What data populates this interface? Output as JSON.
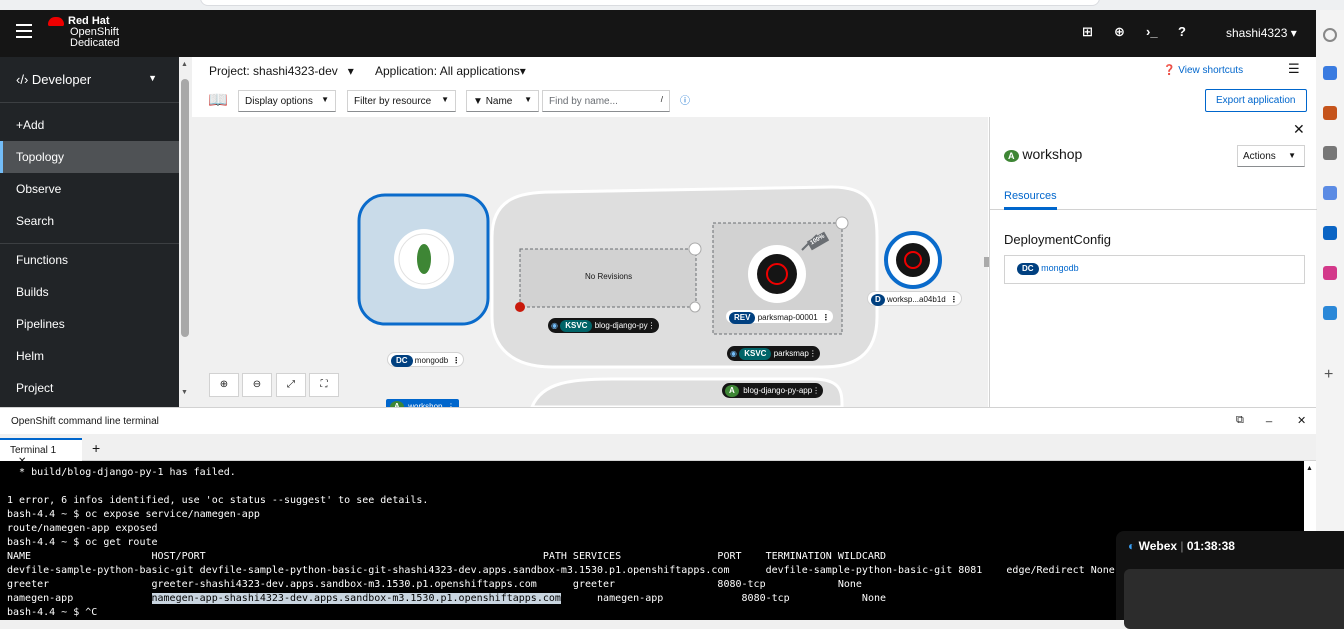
{
  "brand": {
    "line1": "Red Hat",
    "line2": "OpenShift",
    "line3": "Dedicated"
  },
  "masthead": {
    "user": "shashi4323"
  },
  "sidebar": {
    "perspective": "Developer",
    "items": [
      {
        "label": "+Add"
      },
      {
        "label": "Topology",
        "active": true
      },
      {
        "label": "Observe"
      },
      {
        "label": "Search"
      },
      {
        "label": "Functions"
      },
      {
        "label": "Builds"
      },
      {
        "label": "Pipelines"
      },
      {
        "label": "Helm"
      },
      {
        "label": "Project"
      }
    ]
  },
  "projectbar": {
    "project": "Project: shashi4323-dev",
    "application": "Application: All applications",
    "view_shortcuts": "View shortcuts"
  },
  "toolbar": {
    "display_options": "Display options",
    "filter_by_resource": "Filter by resource",
    "filter_type": "Name",
    "filter_placeholder": "Find by name...",
    "filter_hint": "/",
    "export": "Export application"
  },
  "topology": {
    "mongodb": {
      "badge": "DC",
      "label": "mongodb"
    },
    "workshop_group": {
      "badge": "A",
      "label": "workshop"
    },
    "no_revisions": "No Revisions",
    "blog_ksvc": {
      "badge": "KSVC",
      "label": "blog-django-py"
    },
    "parksmap_rev": {
      "badge": "REV",
      "label": "parksmap-00001",
      "traffic": "100%"
    },
    "parksmap_ksvc": {
      "badge": "KSVC",
      "label": "parksmap"
    },
    "workshop_d": {
      "badge": "D",
      "label": "worksp...a04b1d"
    },
    "blog_app": {
      "badge": "A",
      "label": "blog-django-py-app"
    }
  },
  "panel": {
    "badge": "A",
    "title": "workshop",
    "actions": "Actions",
    "tab": "Resources",
    "section": "DeploymentConfig",
    "resource_badge": "DC",
    "resource": "mongodb"
  },
  "terminal": {
    "title": "OpenShift command line terminal",
    "tab": "Terminal 1",
    "lines": [
      "  * build/blog-django-py-1 has failed.",
      "",
      "1 error, 6 infos identified, use 'oc status --suggest' to see details.",
      "bash-4.4 ~ $ oc expose service/namegen-app",
      "route/namegen-app exposed",
      "bash-4.4 ~ $ oc get route"
    ],
    "table_headers": [
      "NAME",
      "HOST/PORT",
      "PATH",
      "SERVICES",
      "PORT",
      "TERMINATION",
      "WILDCARD"
    ],
    "rows": [
      [
        "devfile-sample-python-basic-git",
        "devfile-sample-python-basic-git-shashi4323-dev.apps.sandbox-m3.1530.p1.openshiftapps.com",
        "",
        "devfile-sample-python-basic-git",
        "8081",
        "edge/Redirect",
        "None"
      ],
      [
        "greeter",
        "greeter-shashi4323-dev.apps.sandbox-m3.1530.p1.openshiftapps.com",
        "",
        "greeter",
        "8080-tcp",
        "",
        "None"
      ],
      [
        "namegen-app",
        "namegen-app-shashi4323-dev.apps.sandbox-m3.1530.p1.openshiftapps.com",
        "",
        "namegen-app",
        "8080-tcp",
        "",
        "None"
      ]
    ],
    "last_line": "bash-4.4 ~ $ ^C"
  },
  "webex": {
    "label": "Webex",
    "time": "01:38:38"
  }
}
